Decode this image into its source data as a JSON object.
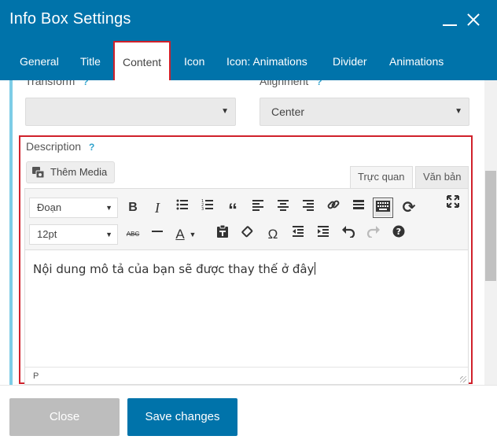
{
  "dialog": {
    "title": "Info Box Settings"
  },
  "tabs": [
    {
      "label": "General"
    },
    {
      "label": "Title"
    },
    {
      "label": "Content"
    },
    {
      "label": "Icon"
    },
    {
      "label": "Icon: Animations"
    },
    {
      "label": "Divider"
    },
    {
      "label": "Animations"
    }
  ],
  "fields": {
    "transform": {
      "label": "Transform",
      "help": "?",
      "value": ""
    },
    "alignment": {
      "label": "Alignment",
      "help": "?",
      "value": "Center"
    },
    "description": {
      "label": "Description",
      "help": "?"
    }
  },
  "editor": {
    "add_media": "Thêm Media",
    "tab_visual": "Trực quan",
    "tab_text": "Văn bản",
    "format_select": "Đoạn",
    "font_size_select": "12pt",
    "content": "Nội dung mô tả của bạn sẽ được thay thế ở đây",
    "path": "P",
    "strikethrough_label": "ABC",
    "bold_label": "B",
    "italic_label": "I",
    "text_color_label": "A",
    "special_char_label": "Ω",
    "help_label": "?"
  },
  "footer": {
    "close_label": "Close",
    "save_label": "Save changes"
  },
  "colors": {
    "header": "#0073aa",
    "highlight": "#d0212b",
    "accent_bar": "#7dcde6",
    "close_btn": "#bdbdbd"
  },
  "icons": [
    "minimize-icon",
    "close-icon",
    "media-icon",
    "bullet-list-icon",
    "numbered-list-icon",
    "blockquote-icon",
    "align-left-icon",
    "align-center-icon",
    "align-right-icon",
    "link-icon",
    "read-more-icon",
    "toolbar-toggle-icon",
    "refresh-icon",
    "fullscreen-icon",
    "horizontal-line-icon",
    "paste-text-icon",
    "clear-format-icon",
    "outdent-icon",
    "indent-icon",
    "undo-icon",
    "redo-icon"
  ]
}
